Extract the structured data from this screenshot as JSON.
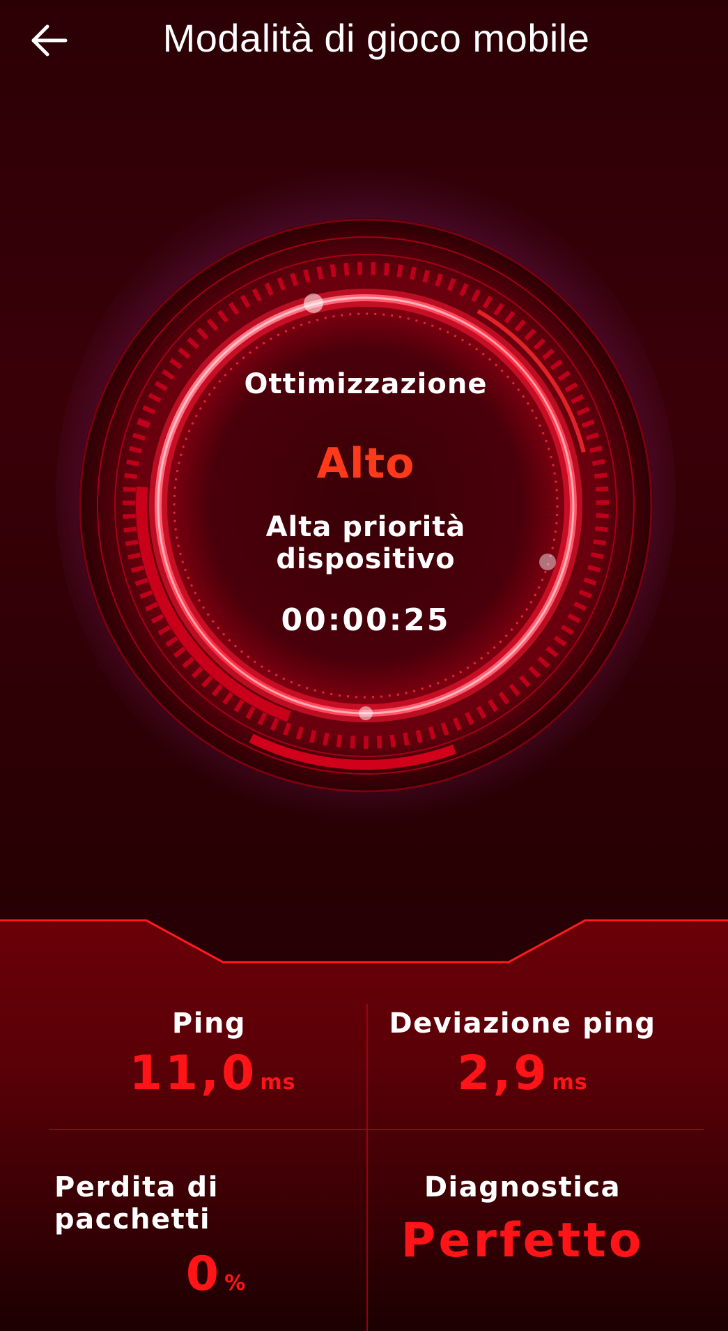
{
  "header": {
    "title": "Modalità di gioco mobile",
    "back_icon": "arrow-left-icon"
  },
  "gauge": {
    "label": "Ottimizzazione",
    "level": "Alto",
    "description_line1": "Alta priorità",
    "description_line2": "dispositivo",
    "timer": "00:00:25"
  },
  "stats": {
    "ping": {
      "title": "Ping",
      "value": "11,0",
      "unit": "ms"
    },
    "ping_deviation": {
      "title": "Deviazione ping",
      "value": "2,9",
      "unit": "ms"
    },
    "packet_loss": {
      "title_line1": "Perdita di",
      "title_line2": "pacchetti",
      "value": "0",
      "unit": "%"
    },
    "diagnostics": {
      "title": "Diagnostica",
      "value": "Perfetto"
    }
  },
  "colors": {
    "accent_red": "#ff1418",
    "level_orange": "#ff3a1a",
    "background": "#2a0004"
  }
}
